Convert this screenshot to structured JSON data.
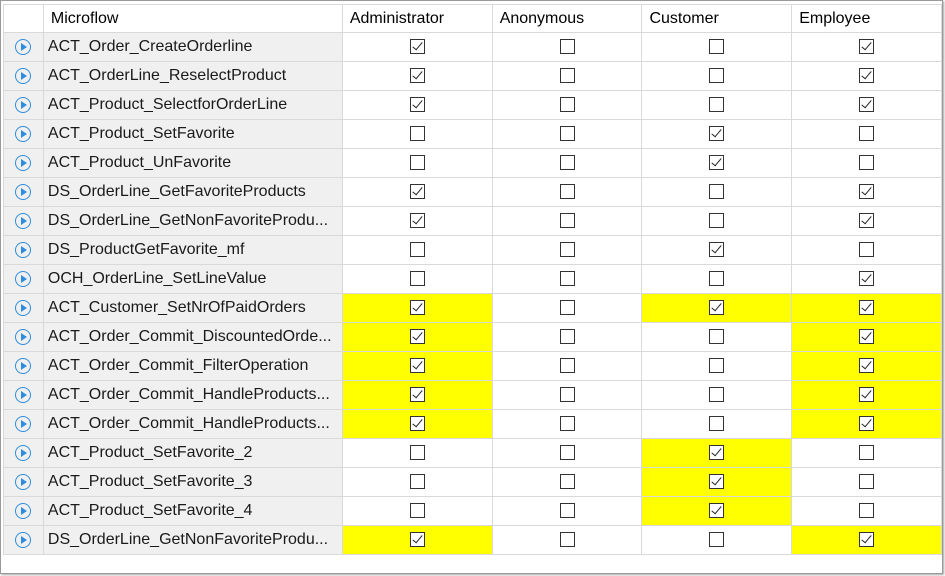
{
  "headers": [
    "Microflow",
    "Administrator",
    "Anonymous",
    "Customer",
    "Employee"
  ],
  "rows": [
    {
      "name": "ACT_Order_CreateOrderline",
      "perms": [
        true,
        false,
        false,
        true
      ],
      "hl": [
        false,
        false,
        false,
        false
      ]
    },
    {
      "name": "ACT_OrderLine_ReselectProduct",
      "perms": [
        true,
        false,
        false,
        true
      ],
      "hl": [
        false,
        false,
        false,
        false
      ]
    },
    {
      "name": "ACT_Product_SelectforOrderLine",
      "perms": [
        true,
        false,
        false,
        true
      ],
      "hl": [
        false,
        false,
        false,
        false
      ]
    },
    {
      "name": "ACT_Product_SetFavorite",
      "perms": [
        false,
        false,
        true,
        false
      ],
      "hl": [
        false,
        false,
        false,
        false
      ]
    },
    {
      "name": "ACT_Product_UnFavorite",
      "perms": [
        false,
        false,
        true,
        false
      ],
      "hl": [
        false,
        false,
        false,
        false
      ]
    },
    {
      "name": "DS_OrderLine_GetFavoriteProducts",
      "perms": [
        true,
        false,
        false,
        true
      ],
      "hl": [
        false,
        false,
        false,
        false
      ]
    },
    {
      "name": "DS_OrderLine_GetNonFavoriteProdu...",
      "perms": [
        true,
        false,
        false,
        true
      ],
      "hl": [
        false,
        false,
        false,
        false
      ]
    },
    {
      "name": "DS_ProductGetFavorite_mf",
      "perms": [
        false,
        false,
        true,
        false
      ],
      "hl": [
        false,
        false,
        false,
        false
      ]
    },
    {
      "name": "OCH_OrderLine_SetLineValue",
      "perms": [
        false,
        false,
        false,
        true
      ],
      "hl": [
        false,
        false,
        false,
        false
      ]
    },
    {
      "name": "ACT_Customer_SetNrOfPaidOrders",
      "perms": [
        true,
        false,
        true,
        true
      ],
      "hl": [
        true,
        false,
        true,
        true
      ]
    },
    {
      "name": "ACT_Order_Commit_DiscountedOrde...",
      "perms": [
        true,
        false,
        false,
        true
      ],
      "hl": [
        true,
        false,
        false,
        true
      ]
    },
    {
      "name": "ACT_Order_Commit_FilterOperation",
      "perms": [
        true,
        false,
        false,
        true
      ],
      "hl": [
        true,
        false,
        false,
        true
      ]
    },
    {
      "name": "ACT_Order_Commit_HandleProducts...",
      "perms": [
        true,
        false,
        false,
        true
      ],
      "hl": [
        true,
        false,
        false,
        true
      ]
    },
    {
      "name": "ACT_Order_Commit_HandleProducts...",
      "perms": [
        true,
        false,
        false,
        true
      ],
      "hl": [
        true,
        false,
        false,
        true
      ]
    },
    {
      "name": "ACT_Product_SetFavorite_2",
      "perms": [
        false,
        false,
        true,
        false
      ],
      "hl": [
        false,
        false,
        true,
        false
      ]
    },
    {
      "name": "ACT_Product_SetFavorite_3",
      "perms": [
        false,
        false,
        true,
        false
      ],
      "hl": [
        false,
        false,
        true,
        false
      ]
    },
    {
      "name": "ACT_Product_SetFavorite_4",
      "perms": [
        false,
        false,
        true,
        false
      ],
      "hl": [
        false,
        false,
        true,
        false
      ]
    },
    {
      "name": "DS_OrderLine_GetNonFavoriteProdu...",
      "perms": [
        true,
        false,
        false,
        true
      ],
      "hl": [
        true,
        false,
        false,
        true
      ]
    }
  ],
  "colors": {
    "highlight": "#ffff00",
    "rowHeader": "#f0f0f0",
    "icon": "#2e8de0"
  },
  "icons": {
    "row": "microflow-play-icon"
  }
}
